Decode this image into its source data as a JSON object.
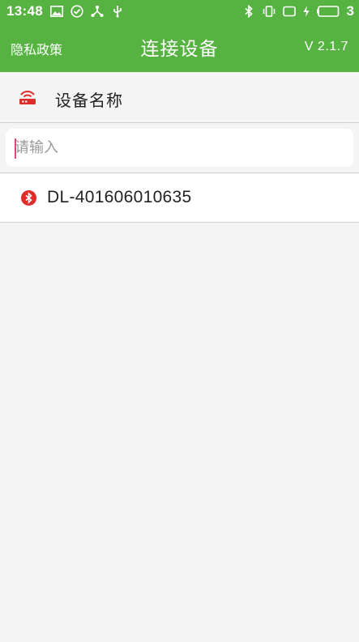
{
  "status_bar": {
    "time": "13:48",
    "battery_level": "3",
    "icons": [
      "image-icon",
      "check-circle-icon",
      "share-icon",
      "usb-icon",
      "bluetooth-icon",
      "vibrate-icon",
      "screen-icon",
      "charging-icon",
      "battery-icon"
    ]
  },
  "app_bar": {
    "privacy_label": "隐私政策",
    "title": "连接设备",
    "version": "V 2.1.7",
    "color": "#56b341"
  },
  "device_header": {
    "label": "设备名称",
    "icon": "router-icon",
    "icon_color": "#e02b2b"
  },
  "search": {
    "placeholder": "请输入",
    "value": ""
  },
  "devices": [
    {
      "name": "DL-401606010635",
      "icon": "bluetooth-badge-icon"
    }
  ]
}
